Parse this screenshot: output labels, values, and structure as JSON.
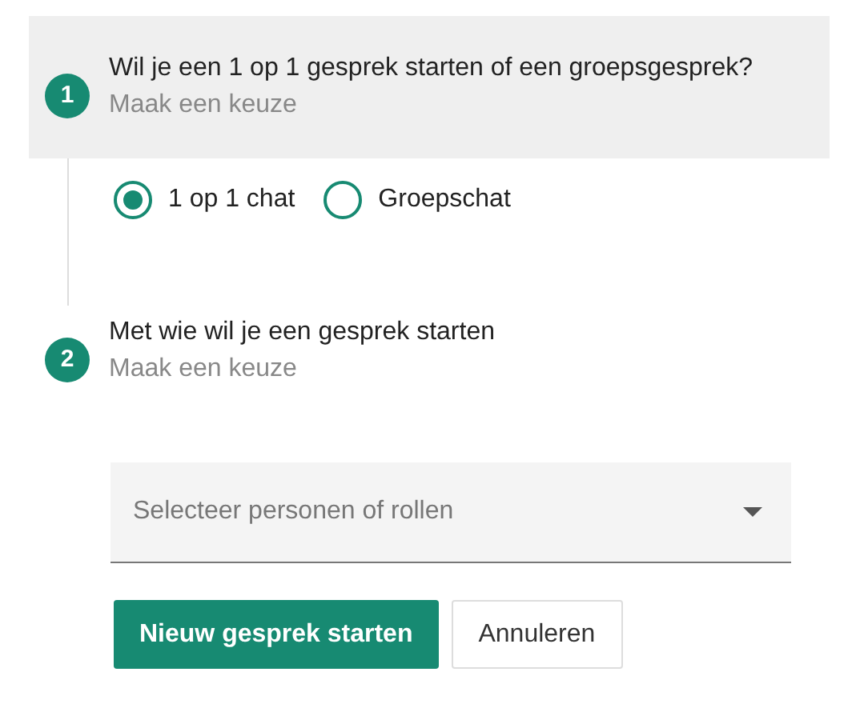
{
  "steps": [
    {
      "number": "1",
      "title": "Wil je een 1 op 1 gesprek starten of een groepsgesprek?",
      "subtitle": "Maak een keuze",
      "selected": true,
      "options": [
        {
          "label": "1 op 1 chat",
          "selected": true
        },
        {
          "label": "Groepschat",
          "selected": false
        }
      ]
    },
    {
      "number": "2",
      "title": "Met wie wil je een gesprek starten",
      "subtitle": "Maak een keuze",
      "selected": false,
      "select": {
        "placeholder": "Selecteer personen of rollen"
      }
    }
  ],
  "buttons": [
    {
      "label": "Nieuw gesprek starten",
      "kind": "primary"
    },
    {
      "label": "Annuleren",
      "kind": "secondary"
    }
  ]
}
